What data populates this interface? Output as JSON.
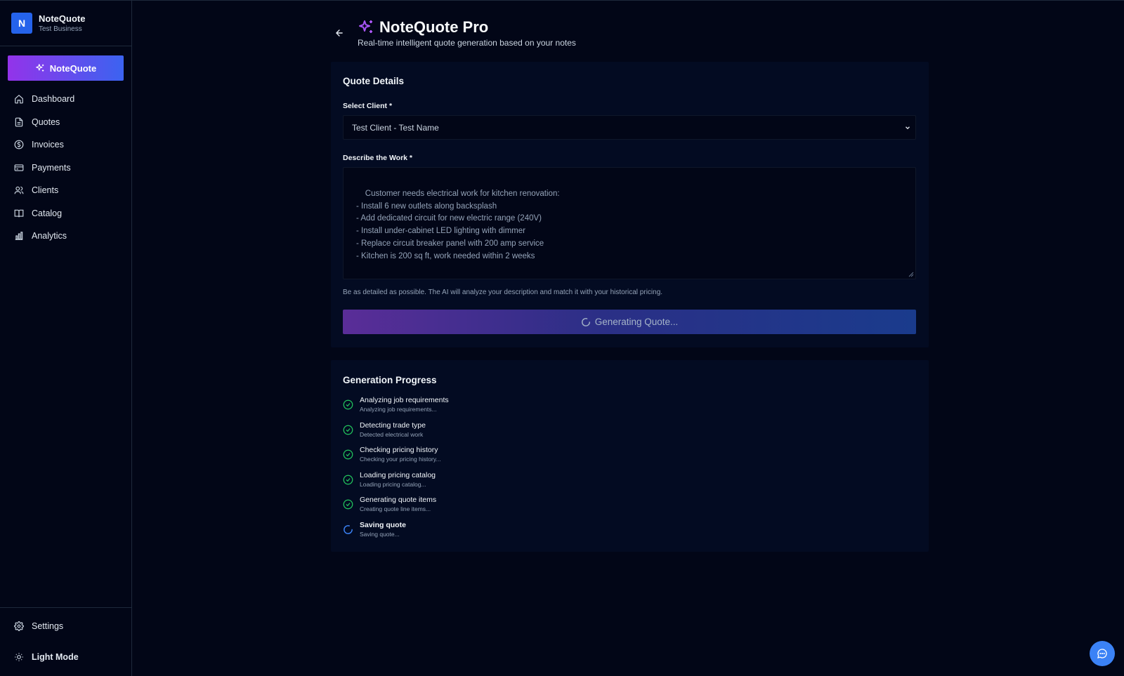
{
  "brand": {
    "initial": "N",
    "name": "NoteQuote",
    "business": "Test Business"
  },
  "sidebar": {
    "cta_label": "NoteQuote",
    "items": [
      {
        "label": "Dashboard",
        "icon": "home-icon"
      },
      {
        "label": "Quotes",
        "icon": "document-icon"
      },
      {
        "label": "Invoices",
        "icon": "dollar-circle-icon"
      },
      {
        "label": "Payments",
        "icon": "credit-card-icon"
      },
      {
        "label": "Clients",
        "icon": "users-icon"
      },
      {
        "label": "Catalog",
        "icon": "book-icon"
      },
      {
        "label": "Analytics",
        "icon": "bar-chart-icon"
      }
    ],
    "settings_label": "Settings",
    "theme_label": "Light Mode"
  },
  "header": {
    "title": "NoteQuote Pro",
    "subtitle": "Real-time intelligent quote generation based on your notes"
  },
  "quote_details": {
    "title": "Quote Details",
    "client_label": "Select Client *",
    "client_value": "Test Client - Test Name",
    "work_label": "Describe the Work *",
    "work_value": "Customer needs electrical work for kitchen renovation:\n- Install 6 new outlets along backsplash\n- Add dedicated circuit for new electric range (240V)\n- Install under-cabinet LED lighting with dimmer\n- Replace circuit breaker panel with 200 amp service\n- Kitchen is 200 sq ft, work needed within 2 weeks",
    "hint": "Be as detailed as possible. The AI will analyze your description and match it with your historical pricing.",
    "generate_label": "Generating Quote..."
  },
  "progress": {
    "title": "Generation Progress",
    "steps": [
      {
        "title": "Analyzing job requirements",
        "detail": "Analyzing job requirements...",
        "status": "done"
      },
      {
        "title": "Detecting trade type",
        "detail": "Detected electrical work",
        "status": "done"
      },
      {
        "title": "Checking pricing history",
        "detail": "Checking your pricing history...",
        "status": "done"
      },
      {
        "title": "Loading pricing catalog",
        "detail": "Loading pricing catalog...",
        "status": "done"
      },
      {
        "title": "Generating quote items",
        "detail": "Creating quote line items...",
        "status": "done"
      },
      {
        "title": "Saving quote",
        "detail": "Saving quote...",
        "status": "in-progress"
      }
    ]
  },
  "colors": {
    "accent_purple": "#9333ea",
    "accent_blue": "#2563eb",
    "success_green": "#22c55e",
    "background": "#020617"
  }
}
